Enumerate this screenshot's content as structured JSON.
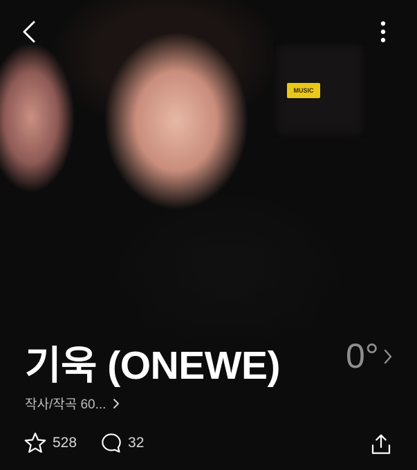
{
  "header": {
    "back_icon": "chevron-left-icon",
    "more_icon": "vertical-dots-icon"
  },
  "hero": {
    "amp_label": "MUSIC"
  },
  "artist": {
    "name": "기욱 (ONEWE)",
    "temperature": "0°",
    "credit_text": "작사/작곡 60..."
  },
  "actions": {
    "like_count": "528",
    "comment_count": "32",
    "share_icon": "share-icon"
  },
  "colors": {
    "background": "#0c0c0c",
    "title": "#ffffff",
    "muted": "#8f8f8f",
    "amp_label": "#e9c81a"
  }
}
